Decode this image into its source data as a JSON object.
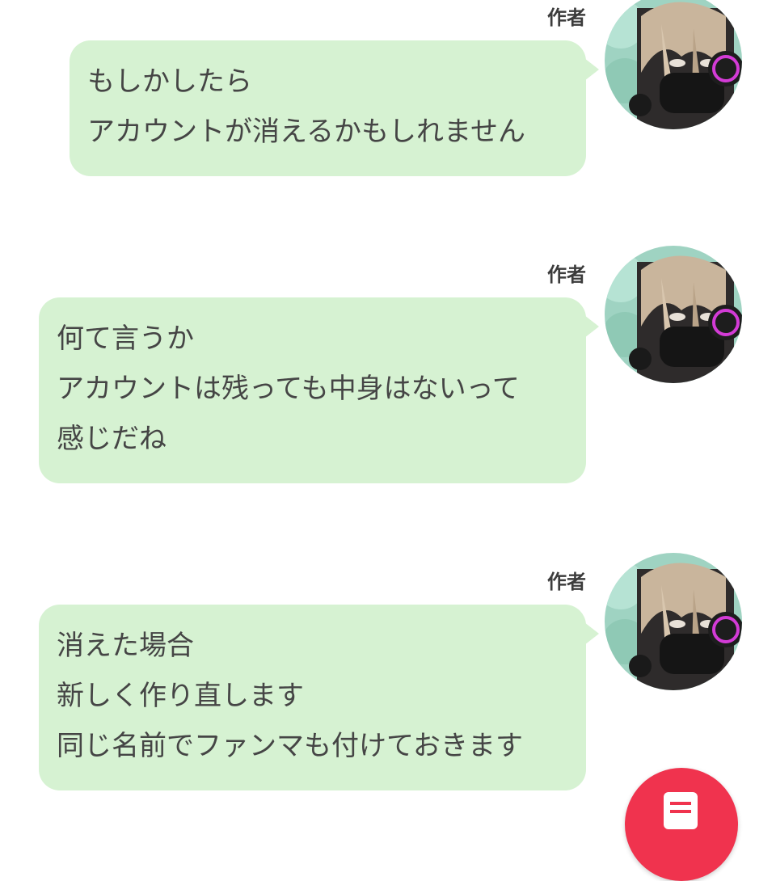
{
  "messages": [
    {
      "author": "作者",
      "lines": [
        "もしかしたら",
        "アカウントが消えるかもしれません"
      ]
    },
    {
      "author": "作者",
      "lines": [
        "何て言うか",
        "アカウントは残っても中身はないって",
        "感じだね"
      ]
    },
    {
      "author": "作者",
      "lines": [
        "消えた場合",
        "新しく作り直します",
        "同じ名前でファンマも付けておきます"
      ]
    }
  ],
  "colors": {
    "bubble": "#d6f2d2",
    "fab": "#f0334e"
  },
  "fab": {
    "icon": "document-icon"
  }
}
